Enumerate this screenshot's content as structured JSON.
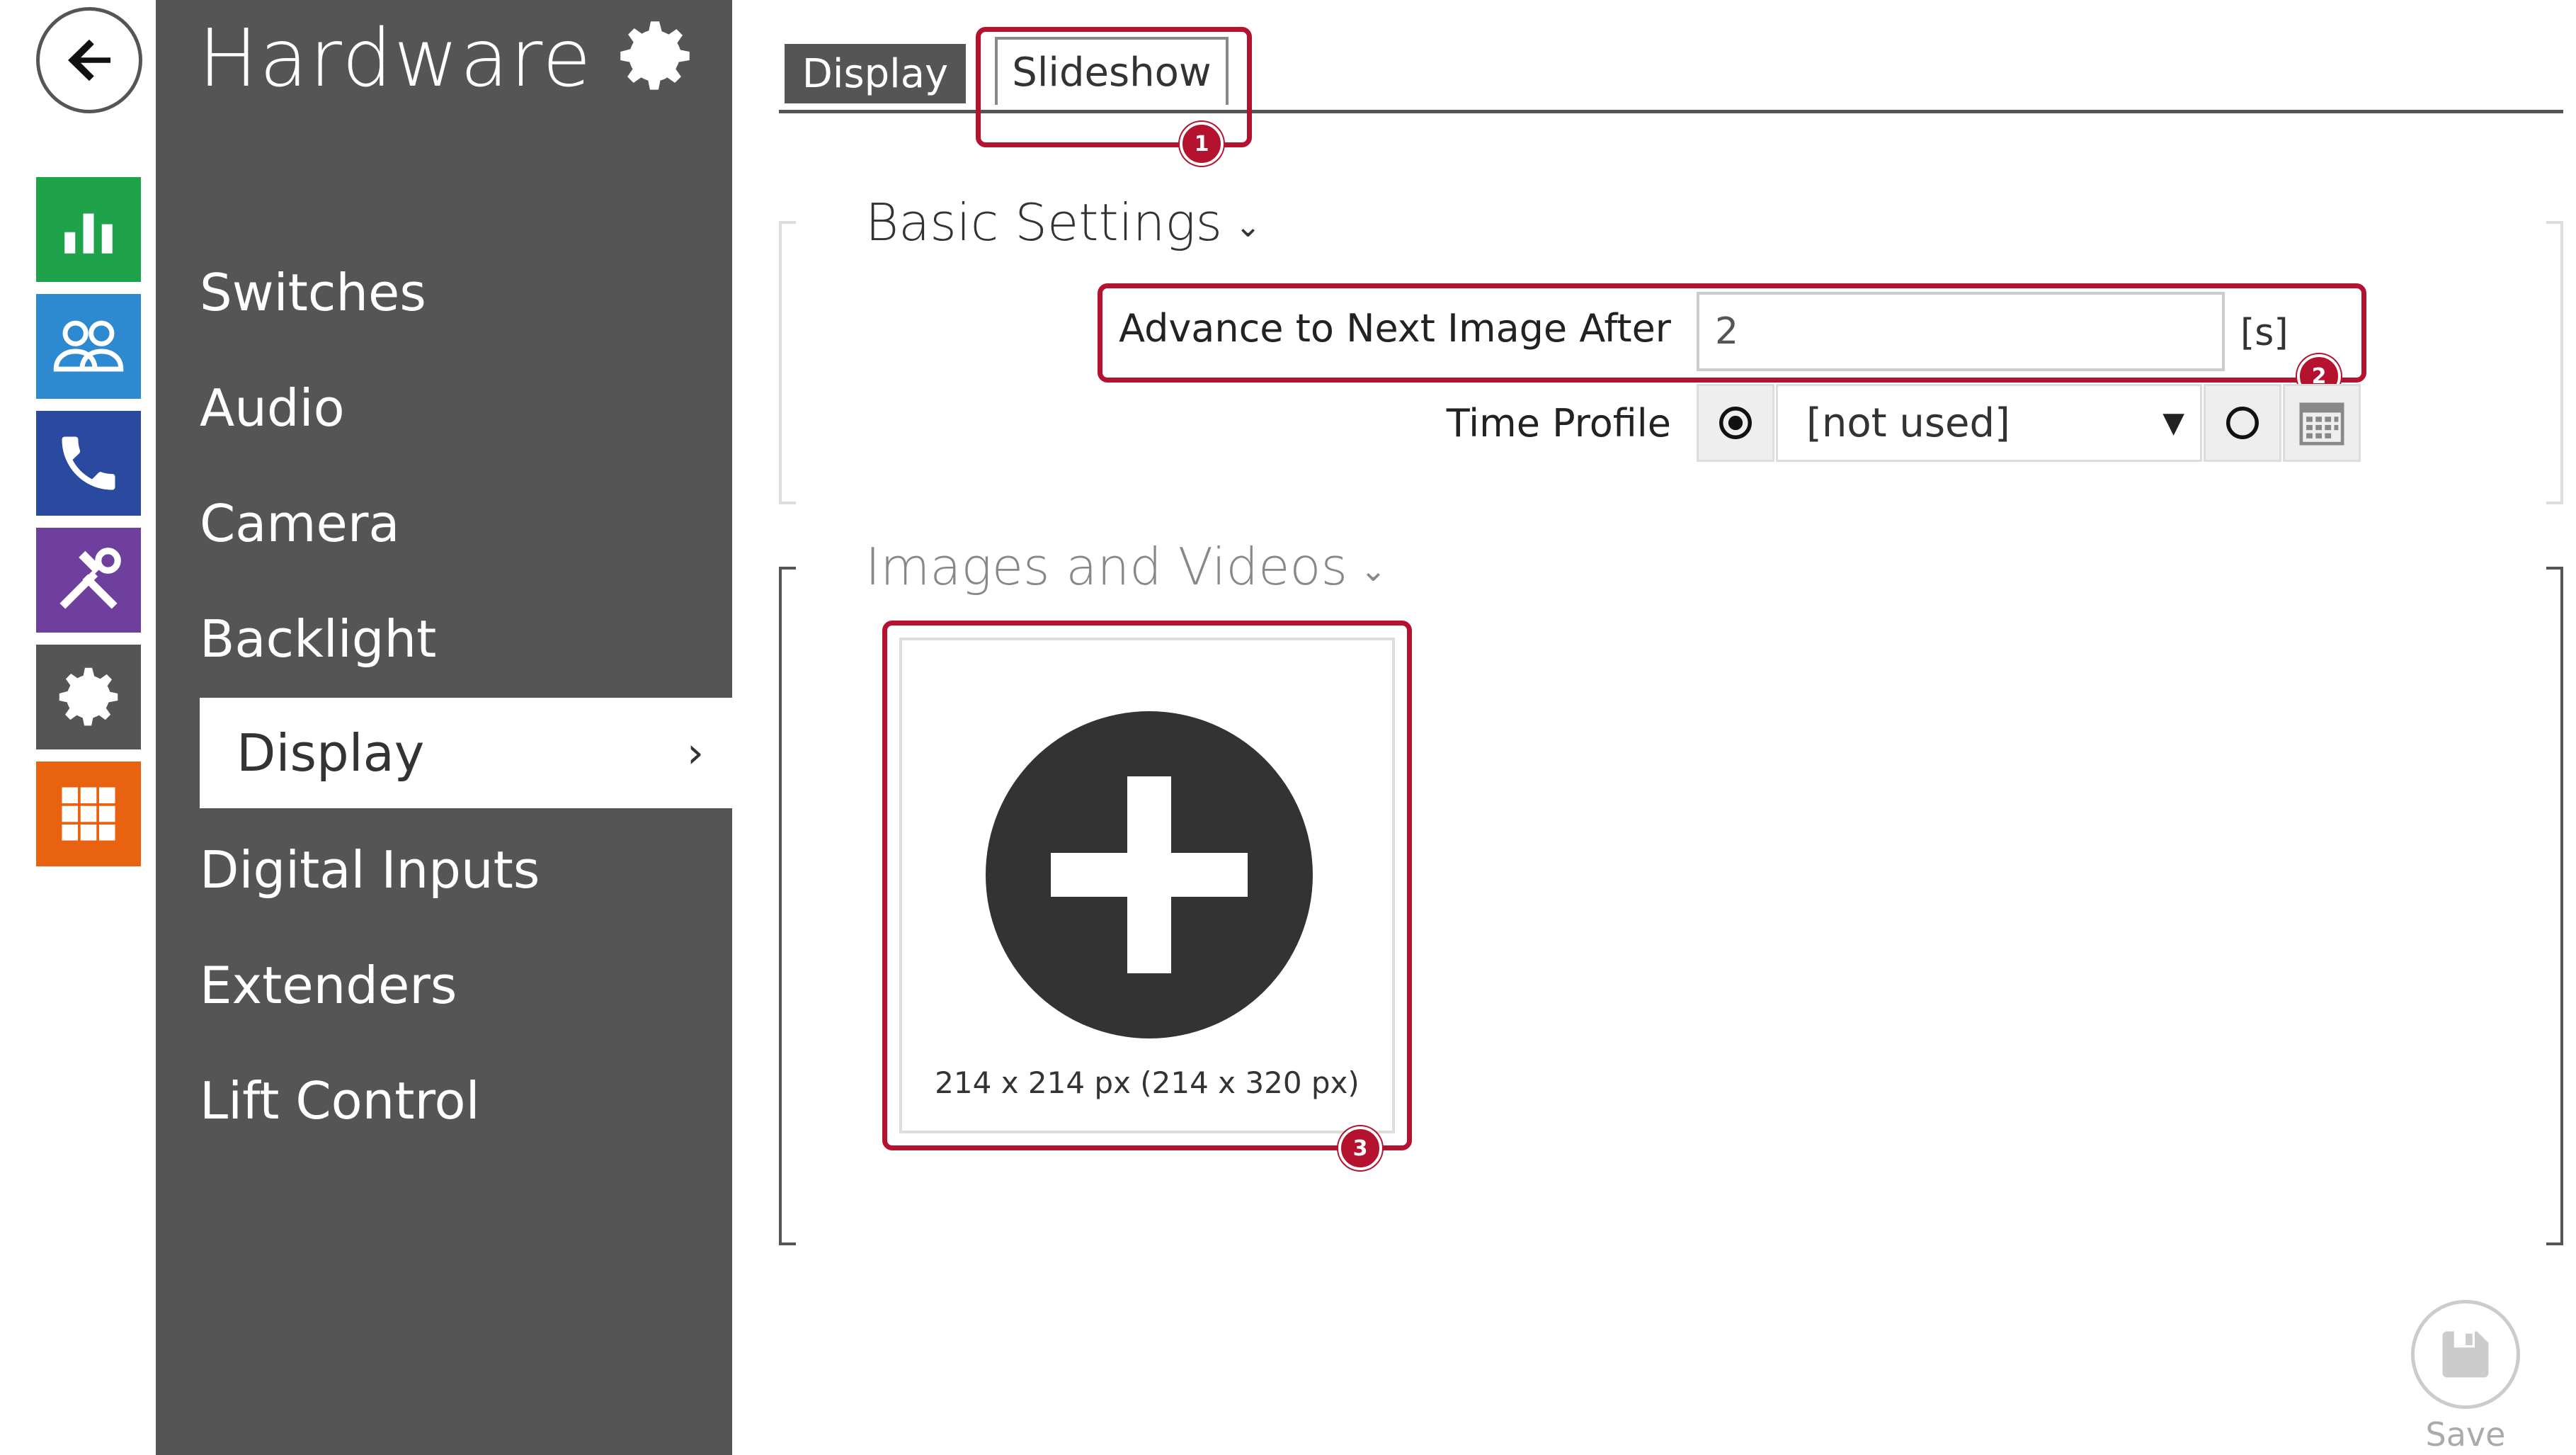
{
  "rail": {
    "back_icon": "back-arrow-icon",
    "tiles": [
      {
        "name": "status",
        "icon": "bar-chart-icon",
        "color": "#1ea24a"
      },
      {
        "name": "directory",
        "icon": "users-icon",
        "color": "#2d89d0"
      },
      {
        "name": "calls",
        "icon": "phone-icon",
        "color": "#2a4aa0"
      },
      {
        "name": "hardware",
        "icon": "tools-icon",
        "color": "#6f3f9d"
      },
      {
        "name": "system",
        "icon": "gear-icon",
        "color": "#555555"
      },
      {
        "name": "services",
        "icon": "grid-icon",
        "color": "#e8620f"
      }
    ]
  },
  "sidebar": {
    "title": "Hardware",
    "items": [
      {
        "label": "Switches"
      },
      {
        "label": "Audio"
      },
      {
        "label": "Camera"
      },
      {
        "label": "Backlight"
      },
      {
        "label": "Display",
        "active": true
      },
      {
        "label": "Digital Inputs"
      },
      {
        "label": "Extenders"
      },
      {
        "label": "Lift Control"
      }
    ]
  },
  "tabs": [
    {
      "label": "Display",
      "active": false
    },
    {
      "label": "Slideshow",
      "active": true
    }
  ],
  "basic": {
    "title": "Basic Settings",
    "advance_label": "Advance to Next Image After",
    "advance_value": "2",
    "advance_unit": "[s]",
    "time_profile_label": "Time Profile",
    "time_profile_value": "[not used]"
  },
  "media": {
    "title": "Images and Videos",
    "upload_caption": "214 x 214 px (214 x 320 px)"
  },
  "badges": [
    "1",
    "2",
    "3"
  ],
  "save_label": "Save",
  "accent": "#b5122f"
}
